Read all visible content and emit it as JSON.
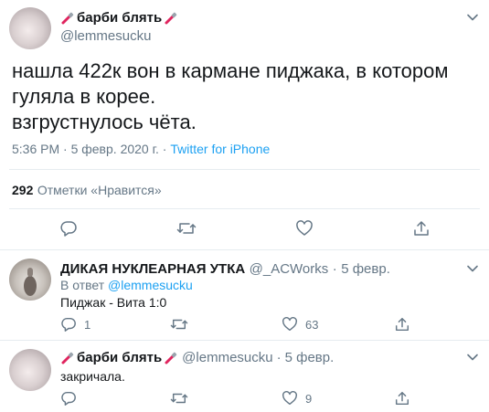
{
  "main_tweet": {
    "display_name": "барби блять",
    "handle": "@lemmesucku",
    "text_lines": [
      "нашла 422к вон в кармане пиджака, в котором",
      "гуляла в корее.",
      "взгрустнулось чёта."
    ],
    "timestamp": "5:36 PM · 5 февр. 2020 г.",
    "source_sep": " · ",
    "source": "Twitter for iPhone",
    "likes_count": "292",
    "likes_label": "Отметки «Нравится»"
  },
  "replies": [
    {
      "display_name": "ДИКАЯ НУКЛЕАРНАЯ УТКА",
      "handle": "@_ACWorks",
      "date": "5 февр.",
      "reply_to_prefix": "В ответ ",
      "reply_to_handle": "@lemmesucku",
      "text": "Пиджак - Вита 1:0",
      "reply_count": "1",
      "retweet_count": "",
      "like_count": "63"
    },
    {
      "display_name": "барби блять",
      "handle": "@lemmesucku",
      "date": "5 февр.",
      "text": "закричала.",
      "reply_count": "",
      "retweet_count": "",
      "like_count": "9"
    }
  ],
  "separator_dot": "·",
  "colors": {
    "text": "#14171a",
    "secondary": "#657786",
    "accent": "#1da1f2",
    "divider": "#e6ecf0",
    "emoji_red": "#e0245e"
  }
}
